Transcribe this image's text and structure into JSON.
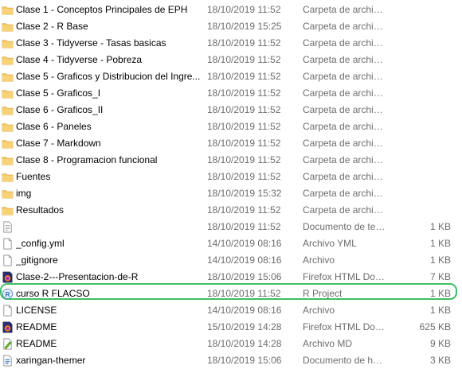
{
  "files": [
    {
      "name": "Clase 1 - Conceptos Principales de EPH",
      "date": "18/10/2019 11:52",
      "type": "Carpeta de archivos",
      "size": "",
      "icon": "folder-icon"
    },
    {
      "name": "Clase 2 - R Base",
      "date": "18/10/2019 15:25",
      "type": "Carpeta de archivos",
      "size": "",
      "icon": "folder-icon"
    },
    {
      "name": "Clase 3 - Tidyverse - Tasas basicas",
      "date": "18/10/2019 11:52",
      "type": "Carpeta de archivos",
      "size": "",
      "icon": "folder-icon"
    },
    {
      "name": "Clase 4 - Tidyverse - Pobreza",
      "date": "18/10/2019 11:52",
      "type": "Carpeta de archivos",
      "size": "",
      "icon": "folder-icon"
    },
    {
      "name": "Clase 5 - Graficos y Distribucion del Ingre...",
      "date": "18/10/2019 11:52",
      "type": "Carpeta de archivos",
      "size": "",
      "icon": "folder-icon"
    },
    {
      "name": "Clase 5 - Graficos_I",
      "date": "18/10/2019 11:52",
      "type": "Carpeta de archivos",
      "size": "",
      "icon": "folder-icon"
    },
    {
      "name": "Clase 6 - Graficos_II",
      "date": "18/10/2019 11:52",
      "type": "Carpeta de archivos",
      "size": "",
      "icon": "folder-icon"
    },
    {
      "name": "Clase 6 - Paneles",
      "date": "18/10/2019 11:52",
      "type": "Carpeta de archivos",
      "size": "",
      "icon": "folder-icon"
    },
    {
      "name": "Clase 7 - Markdown",
      "date": "18/10/2019 11:52",
      "type": "Carpeta de archivos",
      "size": "",
      "icon": "folder-icon"
    },
    {
      "name": "Clase 8 - Programacion funcional",
      "date": "18/10/2019 11:52",
      "type": "Carpeta de archivos",
      "size": "",
      "icon": "folder-icon"
    },
    {
      "name": "Fuentes",
      "date": "18/10/2019 11:52",
      "type": "Carpeta de archivos",
      "size": "",
      "icon": "folder-icon"
    },
    {
      "name": "img",
      "date": "18/10/2019 15:32",
      "type": "Carpeta de archivos",
      "size": "",
      "icon": "folder-icon"
    },
    {
      "name": "Resultados",
      "date": "18/10/2019 11:52",
      "type": "Carpeta de archivos",
      "size": "",
      "icon": "folder-icon"
    },
    {
      "name": "",
      "date": "18/10/2019 11:52",
      "type": "Documento de tex...",
      "size": "1 KB",
      "icon": "text-document-icon"
    },
    {
      "name": "_config.yml",
      "date": "14/10/2019 08:16",
      "type": "Archivo YML",
      "size": "1 KB",
      "icon": "blank-file-icon"
    },
    {
      "name": "_gitignore",
      "date": "14/10/2019 08:16",
      "type": "Archivo",
      "size": "1 KB",
      "icon": "blank-file-icon"
    },
    {
      "name": "Clase-2---Presentacion-de-R",
      "date": "18/10/2019 15:06",
      "type": "Firefox HTML Doc...",
      "size": "7 KB",
      "icon": "firefox-html-icon"
    },
    {
      "name": "curso R FLACSO",
      "date": "18/10/2019 11:52",
      "type": "R Project",
      "size": "1 KB",
      "icon": "r-project-icon"
    },
    {
      "name": "LICENSE",
      "date": "14/10/2019 08:16",
      "type": "Archivo",
      "size": "1 KB",
      "icon": "blank-file-icon"
    },
    {
      "name": "README",
      "date": "15/10/2019 14:28",
      "type": "Firefox HTML Doc...",
      "size": "625 KB",
      "icon": "firefox-html-icon"
    },
    {
      "name": "README",
      "date": "18/10/2019 14:28",
      "type": "Archivo MD",
      "size": "9 KB",
      "icon": "markdown-file-icon"
    },
    {
      "name": "xaringan-themer",
      "date": "18/10/2019 15:06",
      "type": "Documento de ho...",
      "size": "3 KB",
      "icon": "stylesheet-file-icon"
    }
  ],
  "highlighted_file": "curso R FLACSO",
  "colors": {
    "folder": "#f6c85f",
    "highlight": "#3fbf63",
    "secondary_text": "#6d6d6d"
  }
}
